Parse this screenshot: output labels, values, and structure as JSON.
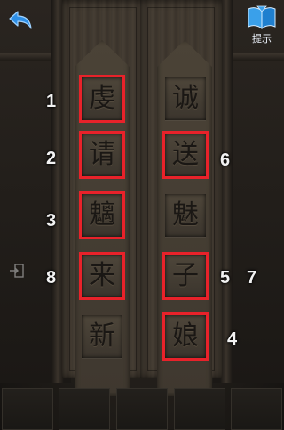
{
  "hint_button": {
    "label": "提示"
  },
  "icons": {
    "back": "back-arrow-icon",
    "hint": "book-icon",
    "exit": "exit-door-icon"
  },
  "colors": {
    "selection": "#e8222a",
    "wood": "#433b31"
  },
  "left_column": [
    {
      "char": "虔",
      "selected": true,
      "numbers": [
        "1"
      ]
    },
    {
      "char": "请",
      "selected": true,
      "numbers": [
        "2"
      ]
    },
    {
      "char": "魑",
      "selected": true,
      "numbers": [
        "3"
      ]
    },
    {
      "char": "来",
      "selected": true,
      "numbers": [
        "8"
      ]
    },
    {
      "char": "新",
      "selected": false,
      "numbers": []
    }
  ],
  "right_column": [
    {
      "char": "诚",
      "selected": false,
      "numbers": []
    },
    {
      "char": "送",
      "selected": true,
      "numbers": [
        "6"
      ]
    },
    {
      "char": "魅",
      "selected": false,
      "numbers": []
    },
    {
      "char": "子",
      "selected": true,
      "numbers": [
        "5",
        "7"
      ]
    },
    {
      "char": "娘",
      "selected": true,
      "numbers": [
        "4"
      ]
    }
  ],
  "answer_slots": 5
}
